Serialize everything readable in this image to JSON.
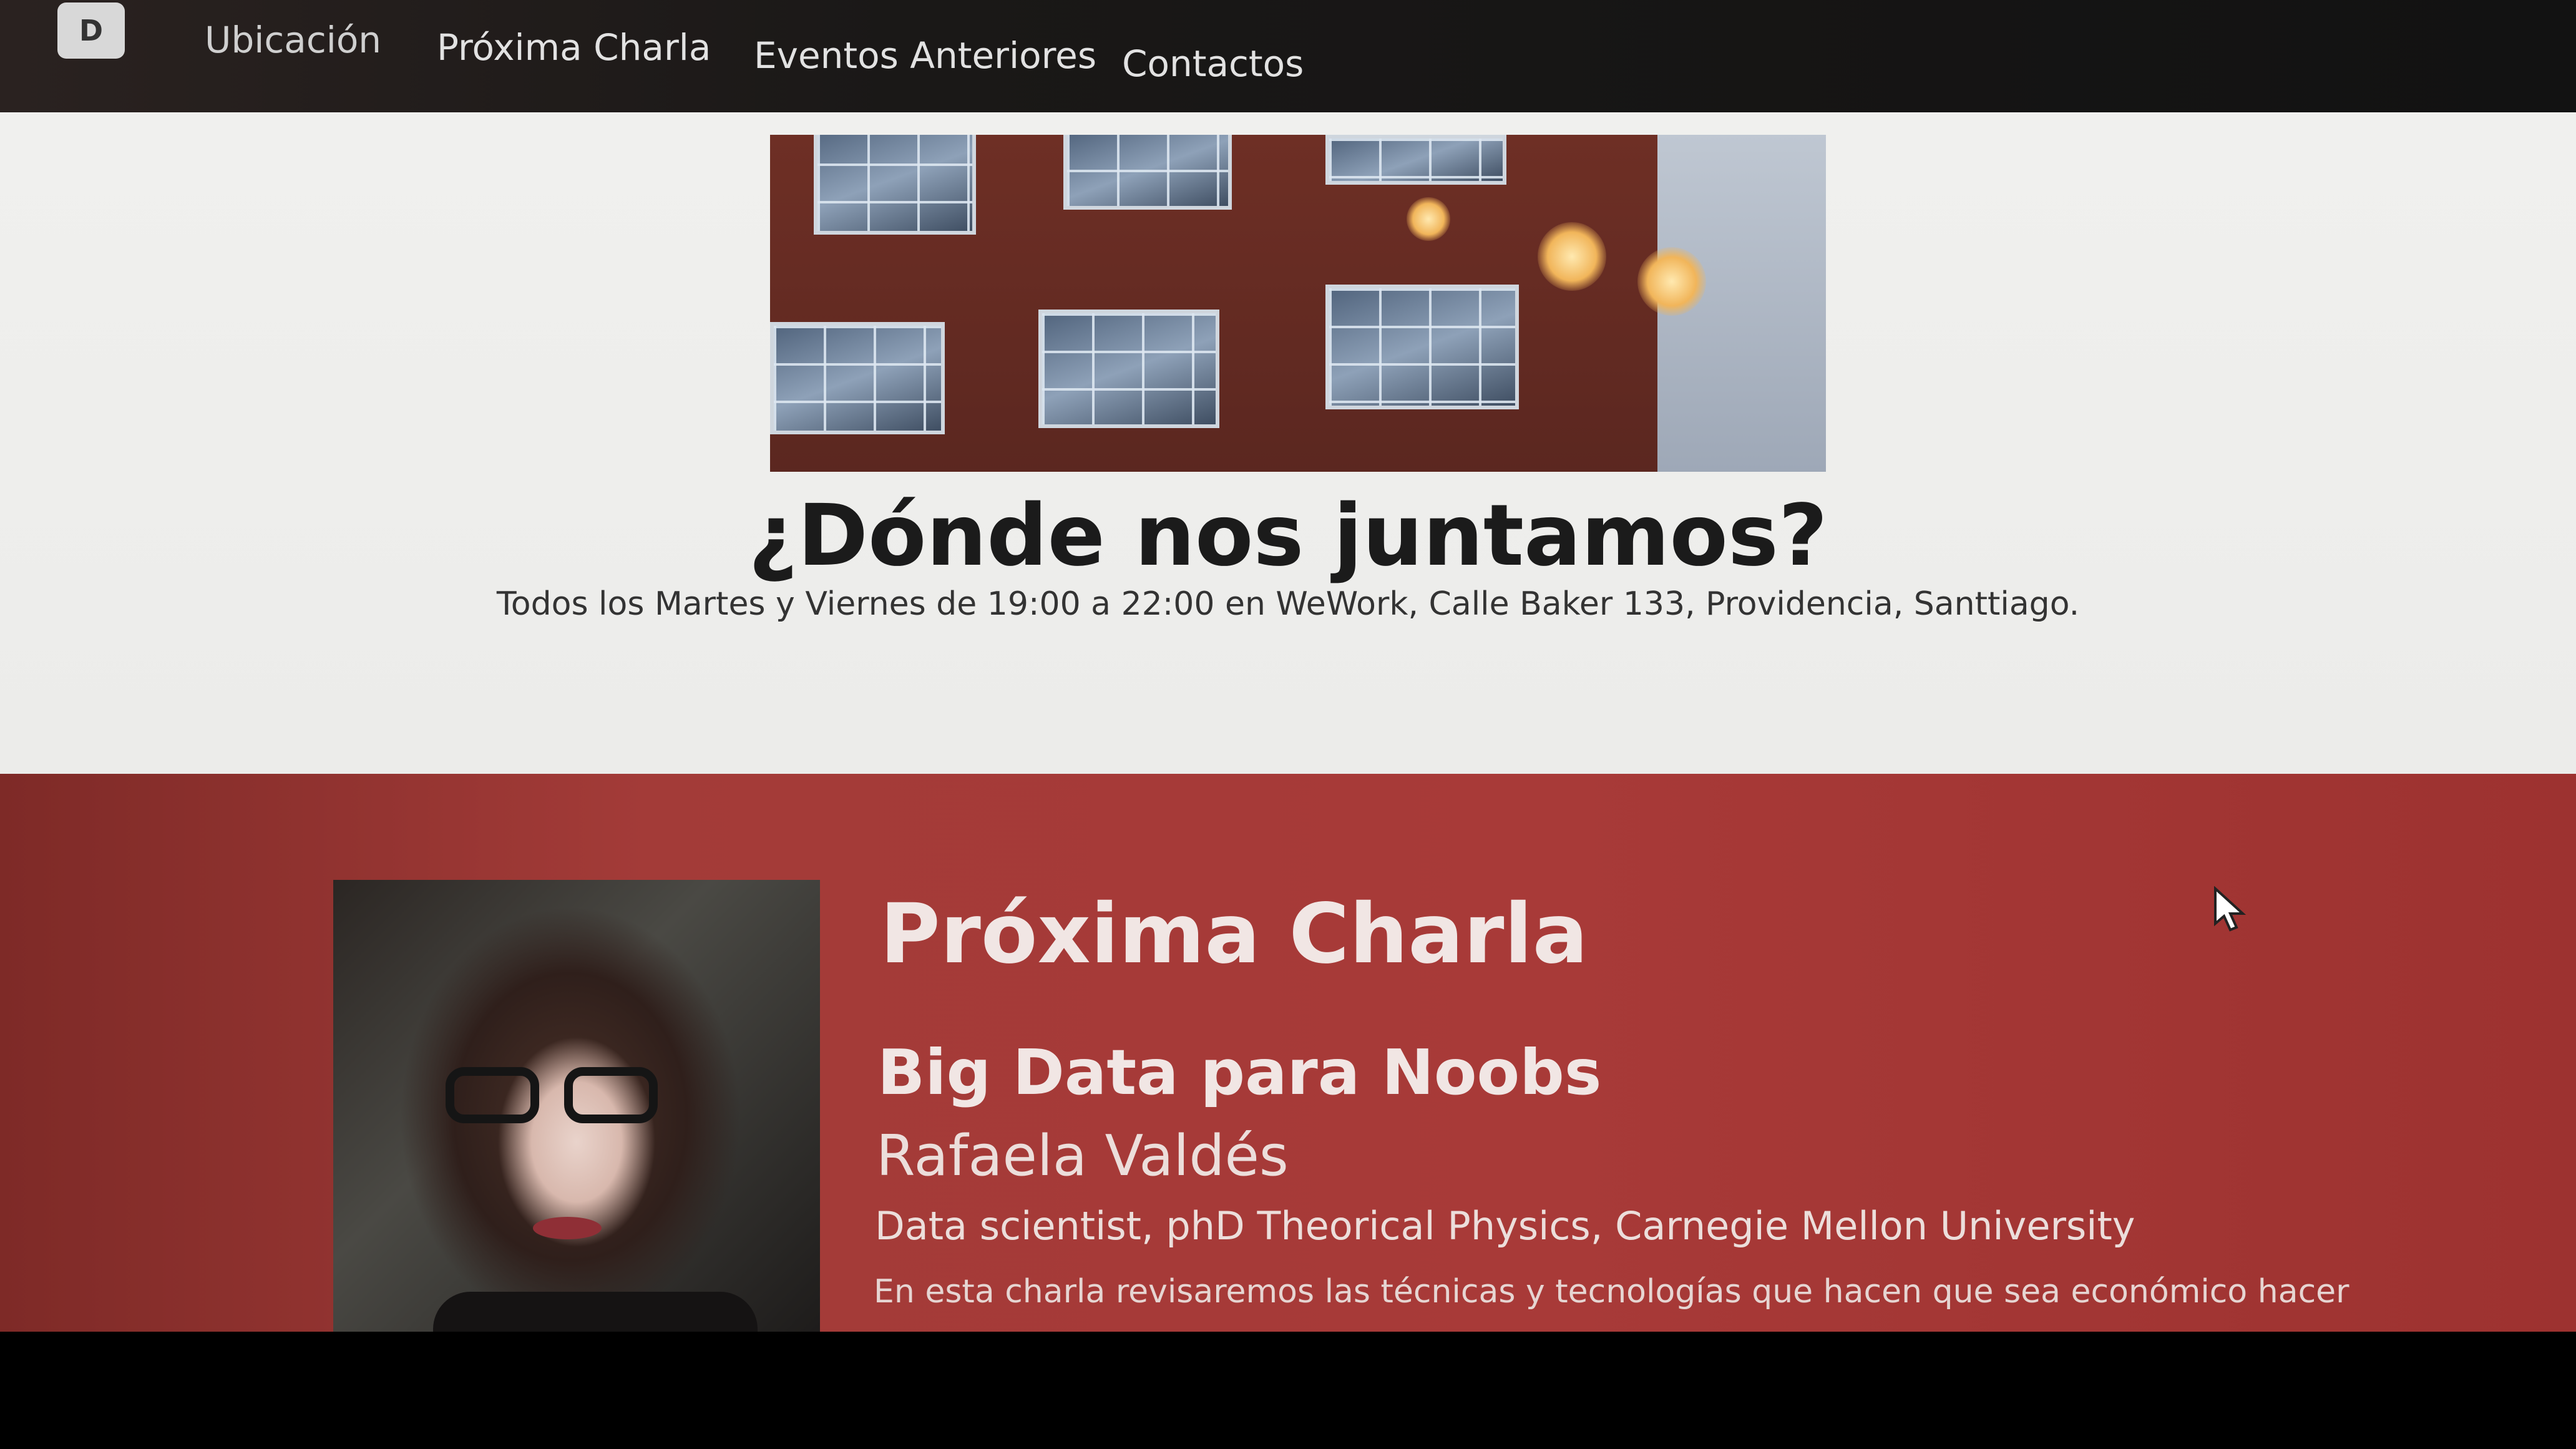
{
  "navbar": {
    "logo_text": "D",
    "items": [
      {
        "label": "Ubicación"
      },
      {
        "label": "Próxima Charla"
      },
      {
        "label": "Eventos Anteriores"
      },
      {
        "label": "Contactos"
      }
    ]
  },
  "location": {
    "title": "¿Dónde nos juntamos?",
    "subtitle": "Todos los Martes y Viernes de 19:00 a 22:00 en WeWork, Calle Baker 133, Providencia, Santtiago."
  },
  "next_talk": {
    "heading": "Próxima Charla",
    "title": "Big Data para Noobs",
    "speaker": "Rafaela Valdés",
    "role": "Data scientist, phD Theorical Physics, Carnegie Mellon University",
    "description": "En esta charla revisaremos las técnicas y tecnologías que hacen que sea económico hacer"
  },
  "colors": {
    "navbar_bg": "#141414",
    "next_talk_bg": "#a33b38",
    "page_bg": "#ededeb"
  }
}
